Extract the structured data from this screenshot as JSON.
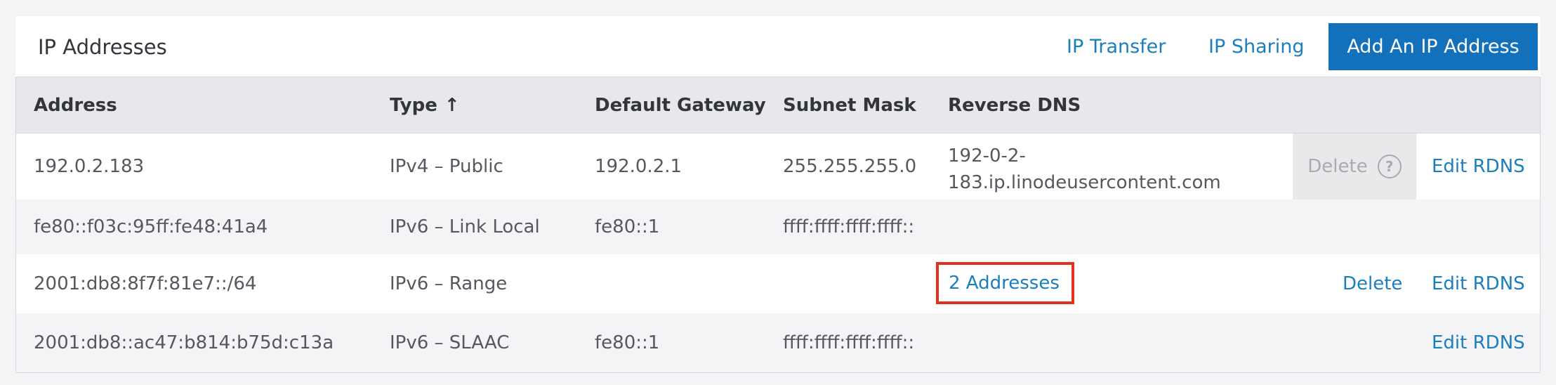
{
  "panel": {
    "title": "IP Addresses",
    "links": {
      "ip_transfer": "IP Transfer",
      "ip_sharing": "IP Sharing"
    },
    "add_button": "Add An IP Address"
  },
  "table": {
    "headers": {
      "address": "Address",
      "type": "Type",
      "type_sort_arrow": "↑",
      "default_gateway": "Default Gateway",
      "subnet_mask": "Subnet Mask",
      "reverse_dns": "Reverse DNS"
    },
    "rows": [
      {
        "address": "192.0.2.183",
        "type": "IPv4 – Public",
        "gateway": "192.0.2.1",
        "subnet_mask": "255.255.255.0",
        "reverse_dns_line1": "192-0-2-",
        "reverse_dns_line2": "183.ip.linodeusercontent.com",
        "delete": "Delete",
        "delete_help": "?",
        "edit_rdns": "Edit RDNS"
      },
      {
        "address": "fe80::f03c:95ff:fe48:41a4",
        "type": "IPv6 – Link Local",
        "gateway": "fe80::1",
        "subnet_mask": "ffff:ffff:ffff:ffff::"
      },
      {
        "address": "2001:db8:8f7f:81e7::/64",
        "type": "IPv6 – Range",
        "reverse_dns_link": "2 Addresses",
        "delete": "Delete",
        "edit_rdns": "Edit RDNS"
      },
      {
        "address": "2001:db8::ac47:b814:b75d:c13a",
        "type": "IPv6 – SLAAC",
        "gateway": "fe80::1",
        "subnet_mask": "ffff:ffff:ffff:ffff::",
        "edit_rdns": "Edit RDNS"
      }
    ]
  },
  "colors": {
    "link": "#1b7fbd",
    "primary_button": "#1371bb",
    "highlight_border": "#e0321e"
  }
}
